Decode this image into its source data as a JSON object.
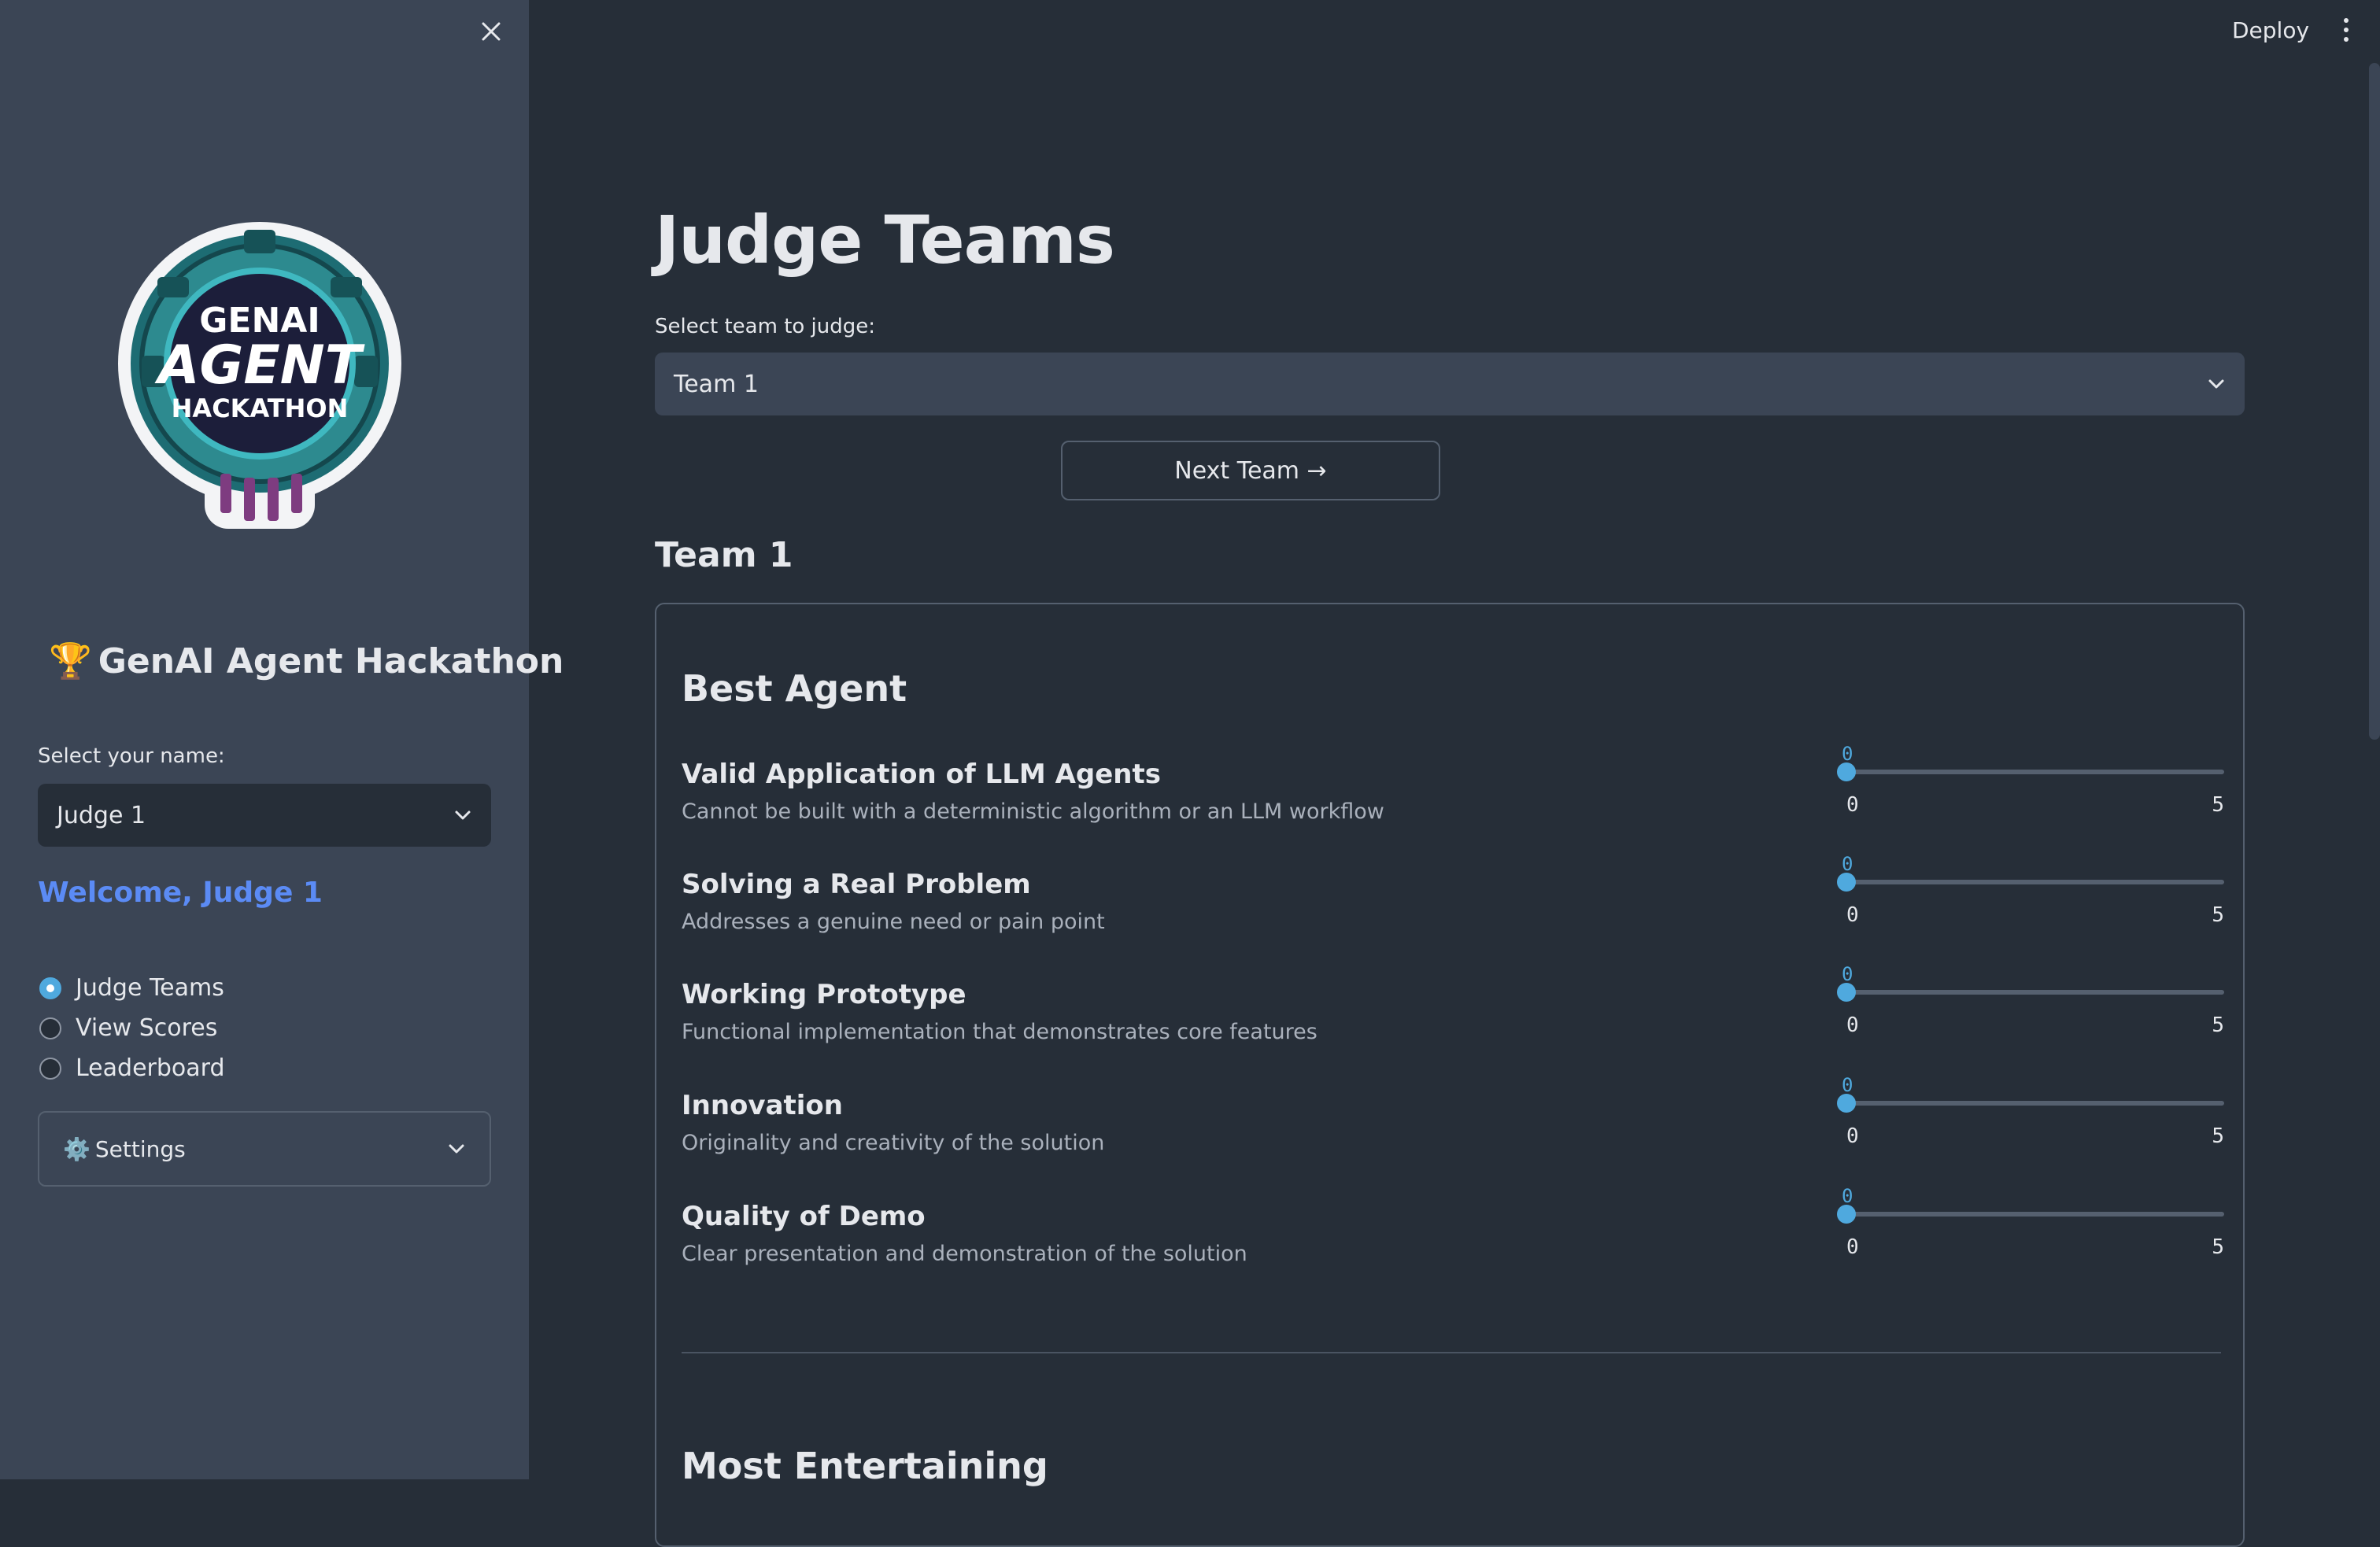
{
  "sidebar": {
    "title": "GenAI Agent Hackathon",
    "trophy": "🏆",
    "logo": {
      "line1": "GENAI",
      "line2": "AGENT",
      "line3": "HACKATHON"
    },
    "name_label": "Select your name:",
    "name_value": "Judge 1",
    "welcome": "Welcome, Judge 1",
    "nav": [
      {
        "label": "Judge Teams",
        "selected": true
      },
      {
        "label": "View Scores",
        "selected": false
      },
      {
        "label": "Leaderboard",
        "selected": false
      }
    ],
    "settings_label": "Settings",
    "settings_icon": "⚙️"
  },
  "header": {
    "deploy": "Deploy"
  },
  "main": {
    "title": "Judge Teams",
    "team_label": "Select team to judge:",
    "team_value": "Team 1",
    "next_button": "Next Team →",
    "team_heading": "Team 1",
    "sections": [
      {
        "title": "Best Agent",
        "criteria": [
          {
            "name": "Valid Application of LLM Agents",
            "desc": "Cannot be built with a deterministic algorithm or an LLM workflow",
            "value": 0,
            "min": 0,
            "max": 5
          },
          {
            "name": "Solving a Real Problem",
            "desc": "Addresses a genuine need or pain point",
            "value": 0,
            "min": 0,
            "max": 5
          },
          {
            "name": "Working Prototype",
            "desc": "Functional implementation that demonstrates core features",
            "value": 0,
            "min": 0,
            "max": 5
          },
          {
            "name": "Innovation",
            "desc": "Originality and creativity of the solution",
            "value": 0,
            "min": 0,
            "max": 5
          },
          {
            "name": "Quality of Demo",
            "desc": "Clear presentation and demonstration of the solution",
            "value": 0,
            "min": 0,
            "max": 5
          }
        ]
      },
      {
        "title": "Most Entertaining"
      }
    ]
  },
  "colors": {
    "accent": "#4fa9de",
    "welcome": "#5b8bf5",
    "sidebar_bg": "#3b4555",
    "main_bg": "#262e38"
  }
}
